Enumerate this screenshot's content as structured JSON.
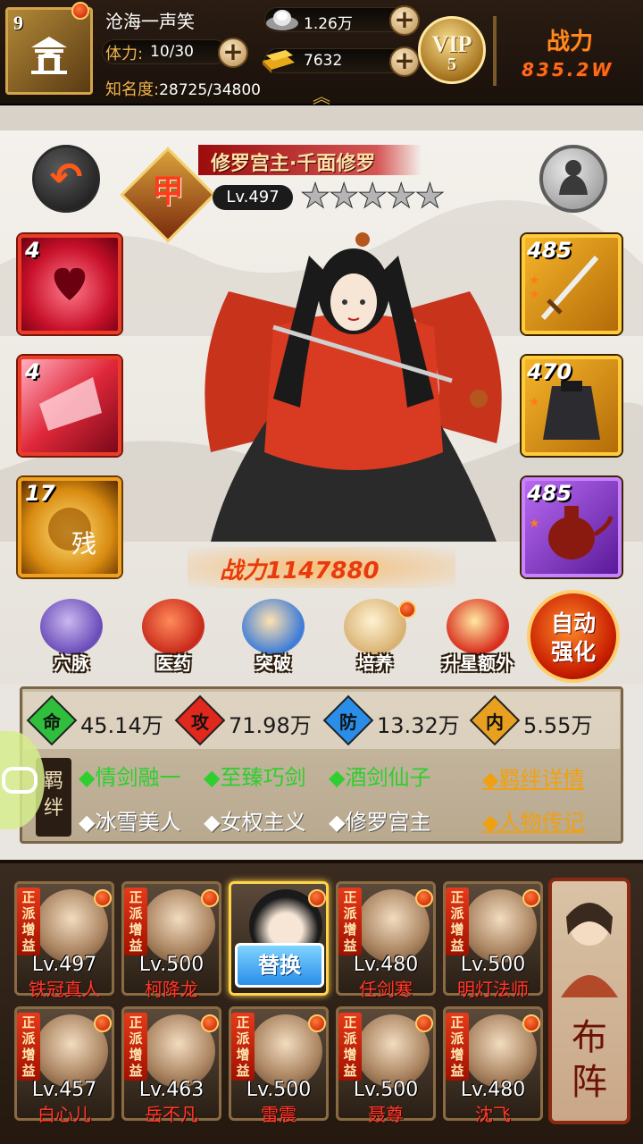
{
  "player": {
    "level": "9",
    "name": "沧海一声笑",
    "stamina_label": "体力:",
    "stamina_value": "10/30",
    "fame_label": "知名度:",
    "fame_value": "28725/34800",
    "silver": "1.26万",
    "gold": "7632",
    "vip_label": "VIP",
    "vip_level": "5",
    "power_label": "战力",
    "power_value": "835.2W"
  },
  "hero": {
    "grade": "甲",
    "title": "修罗宫主·千面修罗",
    "level": "Lv.497",
    "stars_total": 5,
    "stars_lit": 0,
    "combat_power": "战力1147880"
  },
  "skills": [
    {
      "num": "4",
      "color": "#e0283a"
    },
    {
      "num": "4",
      "color": "#e0283a"
    },
    {
      "num": "17",
      "color": "#e8a020"
    }
  ],
  "equipment": [
    {
      "num": "485",
      "icon": "sword-icon"
    },
    {
      "num": "470",
      "icon": "armor-icon"
    },
    {
      "num": "485",
      "icon": "teapot-icon"
    }
  ],
  "functions": [
    {
      "label": "穴脉",
      "icon": "meridian-icon"
    },
    {
      "label": "医药",
      "icon": "medicine-icon"
    },
    {
      "label": "突破",
      "icon": "breakthrough-icon"
    },
    {
      "label": "培养",
      "icon": "scroll-icon"
    },
    {
      "label": "升星额外",
      "icon": "star-up-icon"
    }
  ],
  "auto_button": {
    "line1": "自动",
    "line2": "强化"
  },
  "attributes": [
    {
      "badge": "命",
      "value": "45.14万",
      "color": "#2fbf3c"
    },
    {
      "badge": "攻",
      "value": "71.98万",
      "color": "#e0281c"
    },
    {
      "badge": "防",
      "value": "13.32万",
      "color": "#2a8ee8"
    },
    {
      "badge": "内",
      "value": "5.55万",
      "color": "#e8a020"
    }
  ],
  "bonds": {
    "tag": "羁绊",
    "active": [
      "◆情剑融一",
      "◆至臻巧剑",
      "◆酒剑仙子"
    ],
    "inactive": [
      "◆冰雪美人",
      "◆女权主义",
      "◆修罗宫主"
    ],
    "link_details": "◆羁绊详情",
    "link_bio": "◆人物传记"
  },
  "roster": {
    "tag": "正派增益",
    "swap_label": "替换",
    "formation_label": "布阵",
    "heroes": [
      {
        "lv": "Lv.497",
        "name": "铁冠真人"
      },
      {
        "lv": "Lv.500",
        "name": "柯降龙"
      },
      {
        "lv": "",
        "name": "",
        "selected": true
      },
      {
        "lv": "Lv.480",
        "name": "任剑寒"
      },
      {
        "lv": "Lv.500",
        "name": "明灯法师"
      },
      {
        "lv": "Lv.457",
        "name": "白心儿"
      },
      {
        "lv": "Lv.463",
        "name": "岳不凡"
      },
      {
        "lv": "Lv.500",
        "name": "雷震"
      },
      {
        "lv": "Lv.500",
        "name": "聂尊"
      },
      {
        "lv": "Lv.480",
        "name": "沈飞"
      }
    ]
  }
}
